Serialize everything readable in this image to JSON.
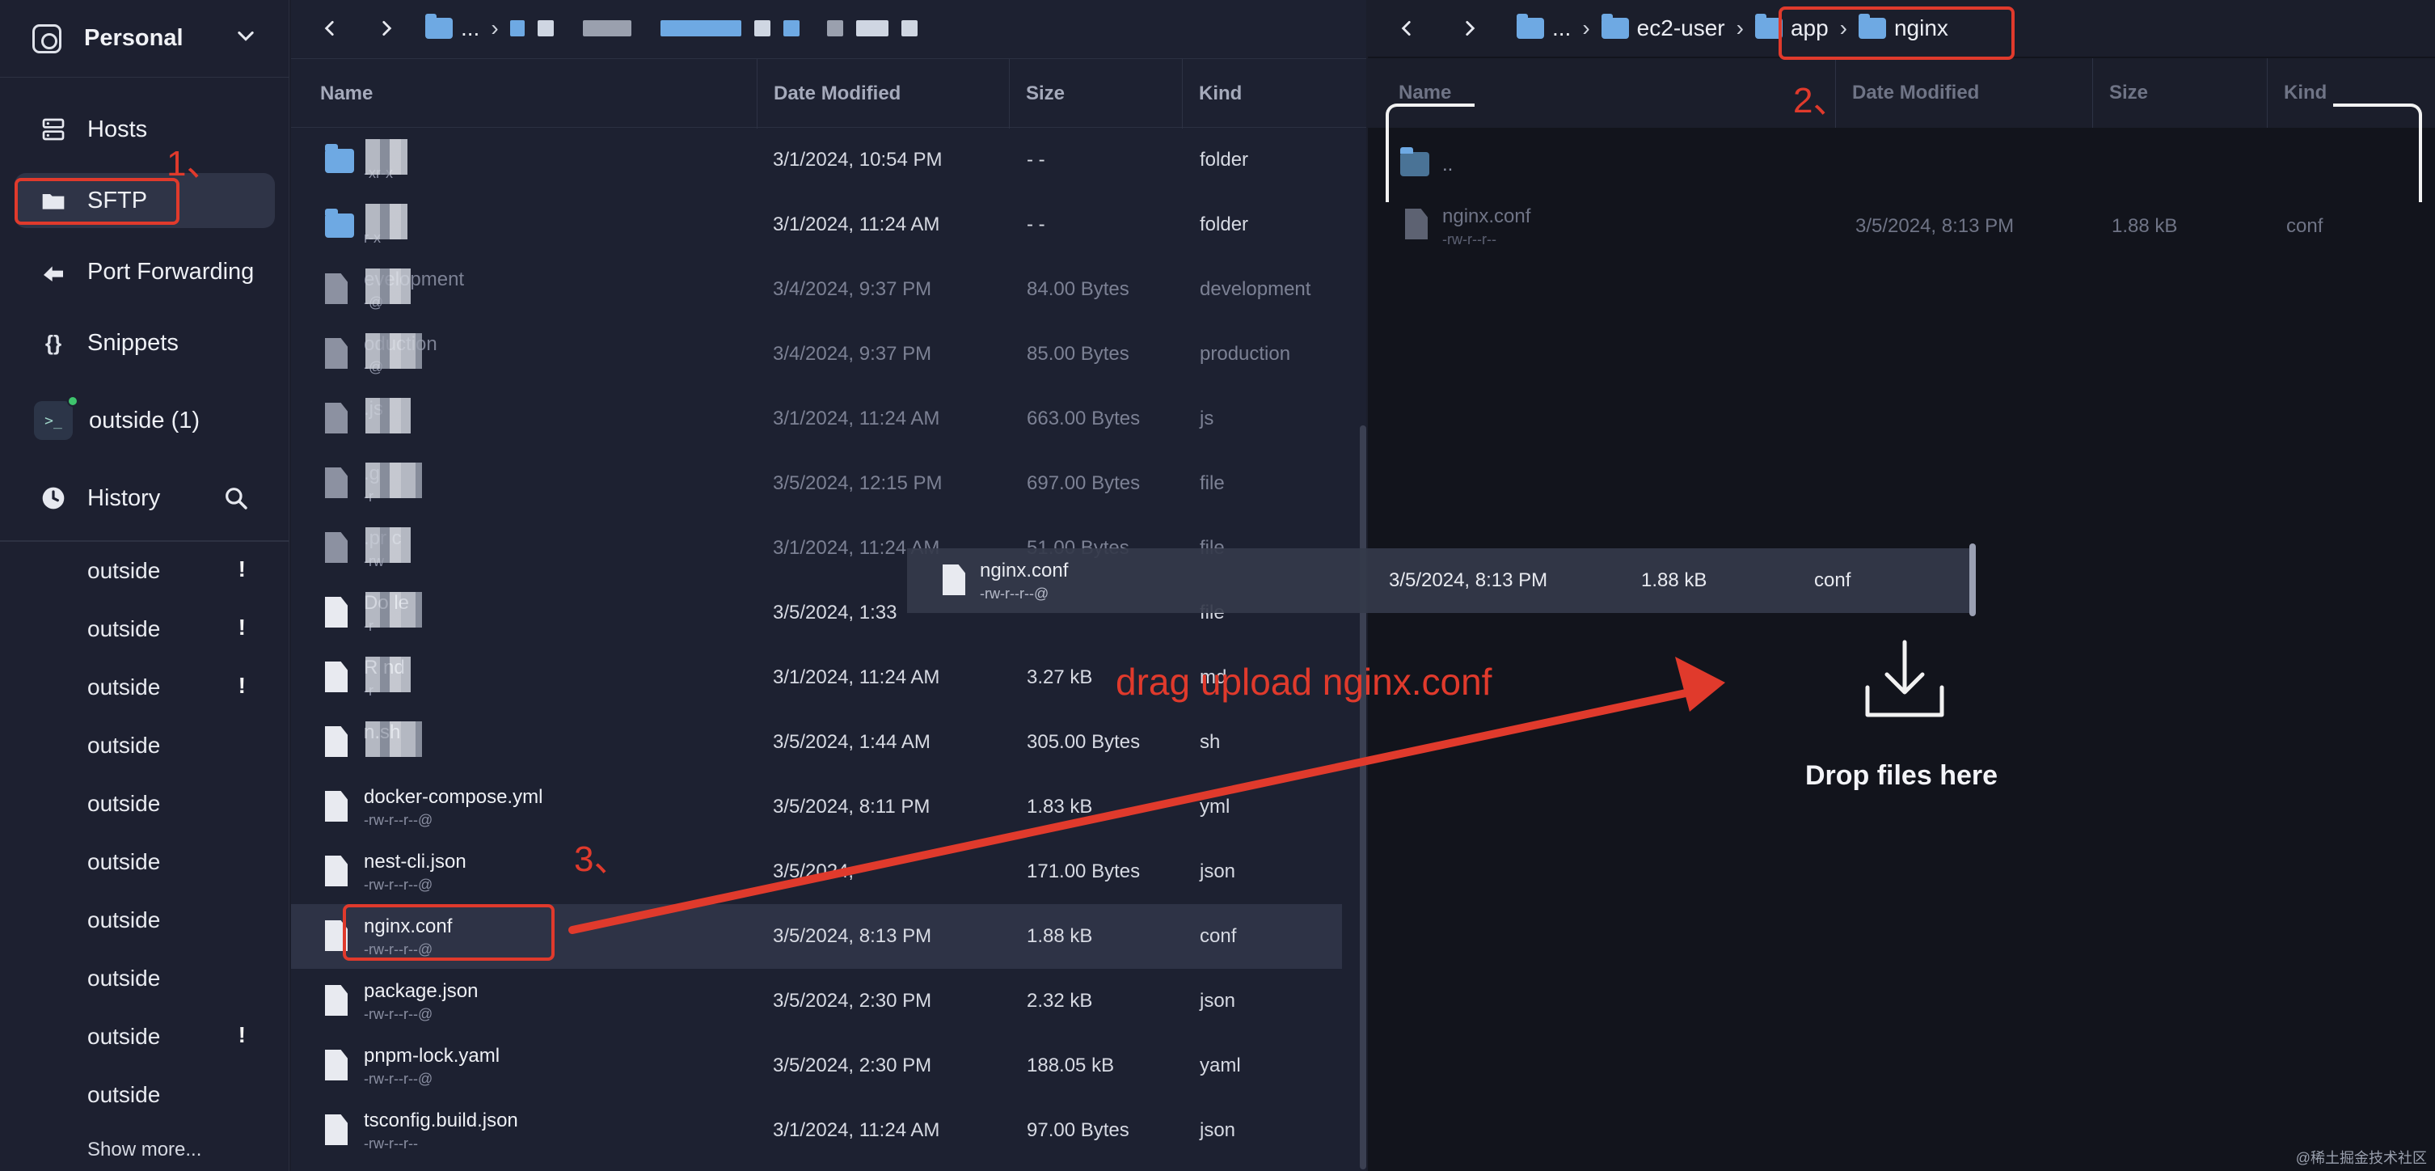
{
  "sidebar": {
    "workspace": "Personal",
    "nav": [
      {
        "label": "Hosts",
        "icon": "hosts-icon"
      },
      {
        "label": "SFTP",
        "icon": "folder-icon"
      },
      {
        "label": "Port Forwarding",
        "icon": "port-forwarding-icon"
      },
      {
        "label": "Snippets",
        "icon": "snippets-icon"
      }
    ],
    "terminal": {
      "label": "outside (1)",
      "prompt": ">_"
    },
    "history": {
      "label": "History"
    },
    "history_items": [
      {
        "label": "outside",
        "warn": "!"
      },
      {
        "label": "outside",
        "warn": "!"
      },
      {
        "label": "outside",
        "warn": "!"
      },
      {
        "label": "outside",
        "warn": ""
      },
      {
        "label": "outside",
        "warn": ""
      },
      {
        "label": "outside",
        "warn": ""
      },
      {
        "label": "outside",
        "warn": ""
      },
      {
        "label": "outside",
        "warn": ""
      },
      {
        "label": "outside",
        "warn": "!"
      },
      {
        "label": "outside",
        "warn": ""
      }
    ],
    "show_more": "Show more..."
  },
  "left_pane": {
    "breadcrumb_ellipsis": "...",
    "columns": {
      "name": "Name",
      "date": "Date Modified",
      "size": "Size",
      "kind": "Kind"
    },
    "files": [
      {
        "name": "",
        "perm": "-xr-x",
        "date": "3/1/2024, 10:54 PM",
        "size": "- -",
        "kind": "folder",
        "type": "folder",
        "dim": false
      },
      {
        "name": "",
        "perm": "r-x",
        "date": "3/1/2024, 11:24 AM",
        "size": "- -",
        "kind": "folder",
        "type": "folder",
        "dim": false
      },
      {
        "name": "evelopment",
        "perm": "-@",
        "date": "3/4/2024, 9:37 PM",
        "size": "84.00 Bytes",
        "kind": "development",
        "type": "file-gray",
        "dim": true
      },
      {
        "name": "oduction",
        "perm": "-@",
        "date": "3/4/2024, 9:37 PM",
        "size": "85.00 Bytes",
        "kind": "production",
        "type": "file-gray",
        "dim": true
      },
      {
        "name": ".js",
        "perm": "",
        "date": "3/1/2024, 11:24 AM",
        "size": "663.00 Bytes",
        "kind": "js",
        "type": "file-gray",
        "dim": true
      },
      {
        "name": ".g",
        "perm": "-r",
        "date": "3/5/2024, 12:15 PM",
        "size": "697.00 Bytes",
        "kind": "file",
        "type": "file-gray",
        "dim": true
      },
      {
        "name": ".pr c",
        "perm": "-rw",
        "date": "3/1/2024, 11:24 AM",
        "size": "51.00 Bytes",
        "kind": "file",
        "type": "file-gray",
        "dim": true
      },
      {
        "name": "Do le",
        "perm": "-r",
        "date": "3/5/2024, 1:33",
        "size": "",
        "kind": "file",
        "type": "file",
        "dim": false
      },
      {
        "name": "R nd",
        "perm": "-r",
        "date": "3/1/2024, 11:24 AM",
        "size": "3.27 kB",
        "kind": "md",
        "type": "file",
        "dim": false
      },
      {
        "name": "n.sh",
        "perm": "",
        "date": "3/5/2024, 1:44 AM",
        "size": "305.00 Bytes",
        "kind": "sh",
        "type": "file",
        "dim": false
      },
      {
        "name": "docker-compose.yml",
        "perm": "-rw-r--r--@",
        "date": "3/5/2024, 8:11 PM",
        "size": "1.83 kB",
        "kind": "yml",
        "type": "yml",
        "dim": false
      },
      {
        "name": "nest-cli.json",
        "perm": "-rw-r--r--@",
        "date": "3/5/2024,",
        "size": "171.00 Bytes",
        "kind": "json",
        "type": "file",
        "dim": false
      },
      {
        "name": "nginx.conf",
        "perm": "-rw-r--r--@",
        "date": "3/5/2024, 8:13 PM",
        "size": "1.88 kB",
        "kind": "conf",
        "type": "file",
        "dim": false,
        "selected": true
      },
      {
        "name": "package.json",
        "perm": "-rw-r--r--@",
        "date": "3/5/2024, 2:30 PM",
        "size": "2.32 kB",
        "kind": "json",
        "type": "file",
        "dim": false
      },
      {
        "name": "pnpm-lock.yaml",
        "perm": "-rw-r--r--@",
        "date": "3/5/2024, 2:30 PM",
        "size": "188.05 kB",
        "kind": "yaml",
        "type": "file",
        "dim": false
      },
      {
        "name": "tsconfig.build.json",
        "perm": "-rw-r--r--",
        "date": "3/1/2024, 11:24 AM",
        "size": "97.00 Bytes",
        "kind": "json",
        "type": "file",
        "dim": false
      }
    ]
  },
  "right_pane": {
    "breadcrumb": [
      "...",
      "ec2-user",
      "app",
      "nginx"
    ],
    "columns": {
      "name": "Name",
      "date": "Date Modified",
      "size": "Size",
      "kind": "Kind"
    },
    "files": [
      {
        "name": "..",
        "perm": "",
        "date": "",
        "size": "",
        "kind": "",
        "type": "folder"
      },
      {
        "name": "nginx.conf",
        "perm": "-rw-r--r--",
        "date": "3/5/2024, 8:13 PM",
        "size": "1.88 kB",
        "kind": "conf",
        "type": "file"
      }
    ],
    "drop_text": "Drop files here"
  },
  "drag_ghost": {
    "name": "nginx.conf",
    "perm": "-rw-r--r--@",
    "date": "3/5/2024, 8:13 PM",
    "size": "1.88 kB",
    "kind": "conf"
  },
  "annotations": {
    "step1": "1、",
    "step2": "2、",
    "step3": "3、",
    "instruction": "drag upload nginx.conf",
    "color": "#e03a2c"
  },
  "watermark": "@稀土掘金技术社区"
}
